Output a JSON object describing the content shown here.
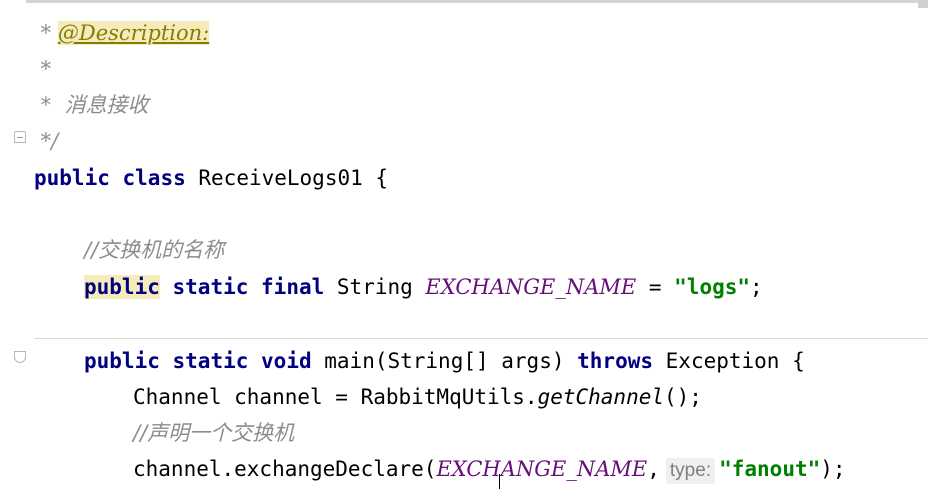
{
  "editor": {
    "lines": {
      "l1": {
        "star": " * ",
        "tag": "@Description:"
      },
      "l2": {
        "text": " *"
      },
      "l3": {
        "text": " *  消息接收"
      },
      "l4": {
        "text": " */"
      },
      "l5": {
        "kw1": "public",
        "kw2": "class",
        "name": "ReceiveLogs01 {"
      },
      "l6": {
        "text": "//交换机的名称"
      },
      "l7": {
        "kw_public": "public",
        "kw_static": "static",
        "kw_final": "final",
        "type": "String",
        "const": "EXCHANGE_NAME",
        "eq": " = ",
        "str": "\"logs\"",
        "end": ";"
      },
      "l8": {
        "kw_public": "public",
        "kw_static": "static",
        "kw_void": "void",
        "sig": "main(String[] args)",
        "kw_throws": "throws",
        "rest": "Exception {"
      },
      "l9": {
        "pre": "Channel channel = RabbitMqUtils.",
        "method": "getChannel",
        "post": "();"
      },
      "l10": {
        "text": "//声明一个交换机"
      },
      "l11": {
        "pre": "channel.exchangeDeclare(",
        "const": "EXCHANGE_NAME",
        "comma": ",",
        "hint": "type:",
        "str": "\"fanout\"",
        "end": ");"
      }
    }
  },
  "colors": {
    "keyword": "#000080",
    "comment": "#8c8c8c",
    "constant": "#660e7a",
    "string": "#008000",
    "doc_tag": "#808000",
    "highlight": "#f6ebbc"
  },
  "icons": {
    "fold_end": "fold-end-icon",
    "fold_start": "fold-start-icon"
  }
}
